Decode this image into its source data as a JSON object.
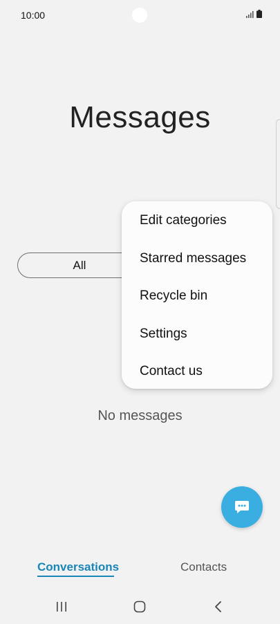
{
  "status_bar": {
    "time": "10:00",
    "icons": [
      "signal-icon",
      "battery-icon"
    ]
  },
  "header": {
    "title": "Messages"
  },
  "filter": {
    "selected": "All"
  },
  "overflow_menu": {
    "items": [
      {
        "label": "Edit categories"
      },
      {
        "label": "Starred messages"
      },
      {
        "label": "Recycle bin"
      },
      {
        "label": "Settings"
      },
      {
        "label": "Contact us"
      }
    ]
  },
  "empty_state": {
    "text": "No messages"
  },
  "fab": {
    "icon": "chat-bubble-icon",
    "color": "#3aaee0"
  },
  "tabs": [
    {
      "label": "Conversations",
      "active": true
    },
    {
      "label": "Contacts",
      "active": false
    }
  ],
  "colors": {
    "accent": "#1985b8",
    "background": "#f2f2f2"
  },
  "nav_bar": {
    "icons": [
      "recents-icon",
      "home-icon",
      "back-icon"
    ]
  }
}
